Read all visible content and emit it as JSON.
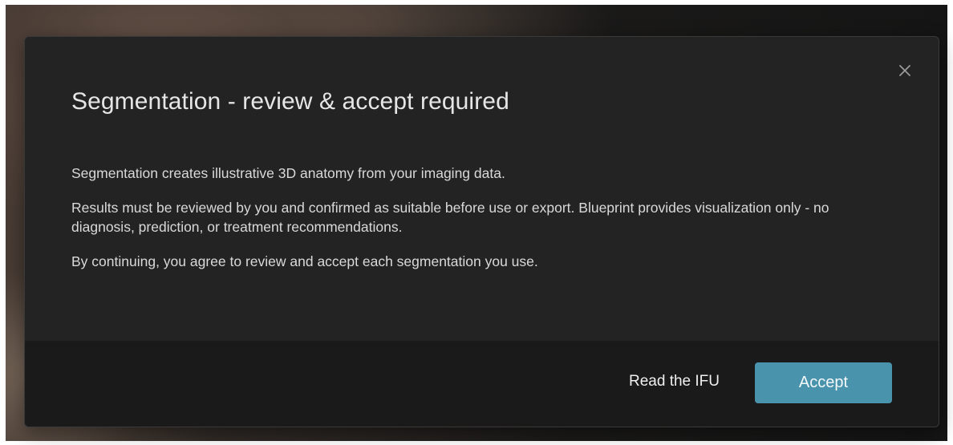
{
  "dialog": {
    "title": "Segmentation - review & accept required",
    "close_icon": "close-icon",
    "paragraphs": [
      "Segmentation creates illustrative 3D anatomy from your imaging data.",
      "Results must be reviewed by you and confirmed as suitable before use or export. Blueprint provides visualization only - no diagnosis, prediction, or treatment recommendations.",
      "By continuing, you agree to review and accept each segmentation you use."
    ],
    "footer": {
      "ifu_label": "Read the IFU",
      "accept_label": "Accept"
    }
  },
  "colors": {
    "dialog_background": "#232323",
    "footer_background": "#1a1a1a",
    "accent": "#4a93ad",
    "text": "#d9d9d9"
  }
}
